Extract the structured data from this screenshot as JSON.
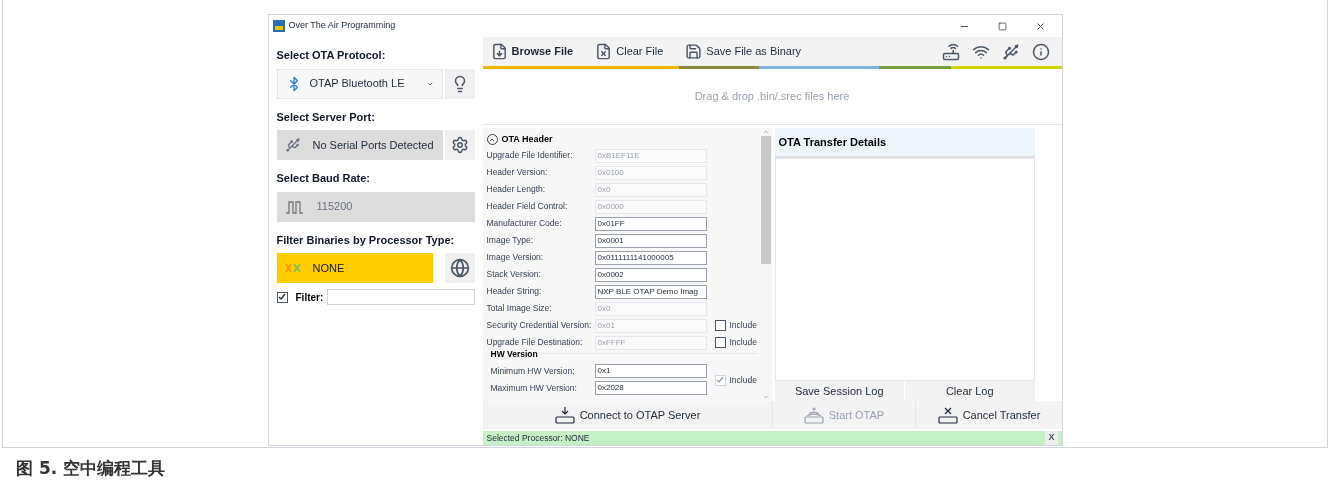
{
  "window": {
    "title": "Over The Air Programming"
  },
  "left_panel": {
    "protocol": {
      "label": "Select OTA Protocol:",
      "value": "OTAP Bluetooth LE"
    },
    "server_port": {
      "label": "Select Server Port:",
      "value": "No Serial Ports Detected"
    },
    "baud_rate": {
      "label": "Select Baud Rate:",
      "value": "115200"
    },
    "processor": {
      "label": "Filter Binaries by Processor Type:",
      "value": "NONE"
    },
    "filter": {
      "label": "Filter:",
      "checked": true
    }
  },
  "toolbar": [
    {
      "label": "Browse File",
      "bold": true
    },
    {
      "label": "Clear File",
      "bold": false
    },
    {
      "label": "Save File as Binary",
      "bold": false
    }
  ],
  "drop_zone": "Drag & drop .bin/.srec files here",
  "ota_header": {
    "title": "OTA Header",
    "expanded": true,
    "fields": [
      {
        "label": "Upgrade File Identifier:",
        "value": "0xB1EF11E",
        "disabled": true
      },
      {
        "label": "Header Version:",
        "value": "0x0100",
        "disabled": true
      },
      {
        "label": "Header Length:",
        "value": "0x0",
        "disabled": true
      },
      {
        "label": "Header Field Control:",
        "value": "0x0000",
        "disabled": true
      },
      {
        "label": "Manufacturer Code:",
        "value": "0x01FF",
        "disabled": false
      },
      {
        "label": "Image Type:",
        "value": "0x0001",
        "disabled": false
      },
      {
        "label": "Image Version:",
        "value": "0x0111111141000005",
        "disabled": false
      },
      {
        "label": "Stack Version:",
        "value": "0x0002",
        "disabled": false
      },
      {
        "label": "Header String:",
        "value": "NXP BLE OTAP Demo Imag",
        "disabled": false
      },
      {
        "label": "Total Image Size:",
        "value": "0x0",
        "disabled": true
      },
      {
        "label": "Security Credential Version:",
        "value": "0x01",
        "disabled": true,
        "include": {
          "label": "Include",
          "checked": false
        }
      },
      {
        "label": "Upgrade File Destination:",
        "value": "0xFFFF",
        "disabled": true,
        "include": {
          "label": "Include",
          "checked": false
        }
      }
    ],
    "hw_version": {
      "title": "HW Version",
      "fields": [
        {
          "label": "Minimum HW Version:",
          "value": "0x1",
          "disabled": false
        },
        {
          "label": "Maximum HW Version:",
          "value": "0x2028",
          "disabled": false
        }
      ],
      "include": {
        "label": "Include",
        "checked": true,
        "disabled": true
      }
    }
  },
  "transfer_details": {
    "title": "OTA Transfer Details"
  },
  "log_buttons": [
    "Save Session Log",
    "Clear Log"
  ],
  "actions": [
    {
      "label": "Connect to OTAP Server",
      "disabled": false
    },
    {
      "label": "Start OTAP",
      "disabled": true
    },
    {
      "label": "Cancel Transfer",
      "disabled": false
    }
  ],
  "status_bar": {
    "text": "Selected Processor: NONE",
    "close": "X"
  },
  "caption": "图 5. 空中编程工具"
}
